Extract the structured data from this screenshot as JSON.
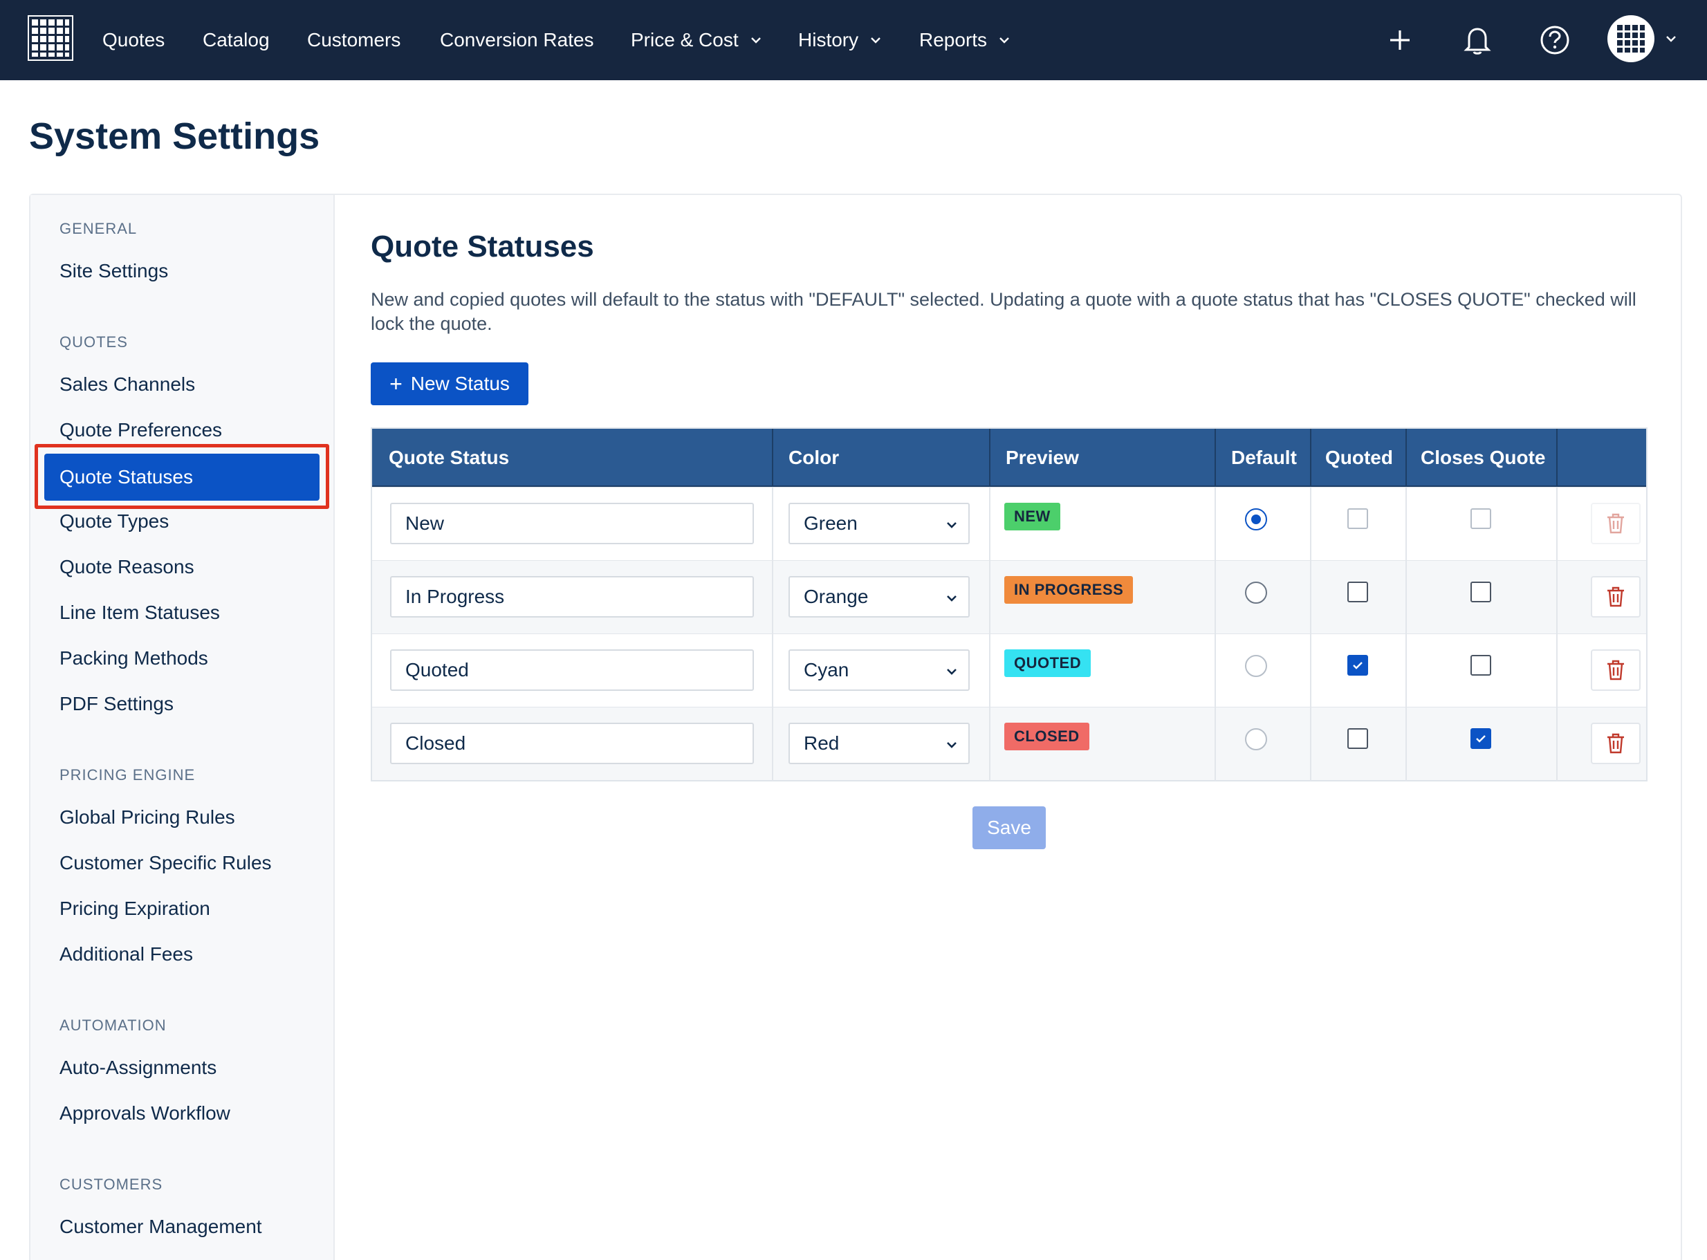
{
  "nav": {
    "logo_icon": "grid-logo-icon",
    "items": [
      {
        "label": "Quotes"
      },
      {
        "label": "Catalog"
      },
      {
        "label": "Customers"
      },
      {
        "label": "Conversion Rates"
      },
      {
        "label": "Price & Cost"
      },
      {
        "label": "History"
      },
      {
        "label": "Reports"
      }
    ],
    "icons": [
      "plus-icon",
      "bell-icon",
      "help-icon",
      "avatar-icon"
    ]
  },
  "page": {
    "title": "System Settings"
  },
  "sidebar": {
    "sections": [
      {
        "heading": "GENERAL",
        "items": [
          "Site Settings"
        ]
      },
      {
        "heading": "QUOTES",
        "items": [
          "Sales Channels",
          "Quote Preferences",
          "Quote Statuses",
          "Quote Types",
          "Quote Reasons",
          "Line Item Statuses",
          "Packing Methods",
          "PDF Settings"
        ]
      },
      {
        "heading": "PRICING ENGINE",
        "items": [
          "Global Pricing Rules",
          "Customer Specific Rules",
          "Pricing Expiration",
          "Additional Fees"
        ]
      },
      {
        "heading": "AUTOMATION",
        "items": [
          "Auto-Assignments",
          "Approvals Workflow"
        ]
      },
      {
        "heading": "CUSTOMERS",
        "items": [
          "Customer Management"
        ]
      }
    ],
    "active": "Quote Statuses"
  },
  "main": {
    "title": "Quote Statuses",
    "description": "New and copied quotes will default to the status with \"DEFAULT\" selected. Updating a quote with a quote status that has \"CLOSES QUOTE\" checked will lock the quote.",
    "new_button": "New Status",
    "save_button": "Save",
    "columns": [
      "Quote Status",
      "Color",
      "Preview",
      "Default",
      "Quoted",
      "Closes Quote"
    ],
    "rows": [
      {
        "name": "New",
        "color": "Green",
        "preview": "NEW",
        "preview_bg": "#4ccf6b",
        "default": true,
        "quoted": false,
        "closes": false
      },
      {
        "name": "In Progress",
        "color": "Orange",
        "preview": "IN PROGRESS",
        "preview_bg": "#f08a3c",
        "default": false,
        "quoted": false,
        "closes": false
      },
      {
        "name": "Quoted",
        "color": "Cyan",
        "preview": "QUOTED",
        "preview_bg": "#35e2f2",
        "default": false,
        "quoted": true,
        "closes": false
      },
      {
        "name": "Closed",
        "color": "Red",
        "preview": "CLOSED",
        "preview_bg": "#f06b66",
        "default": false,
        "quoted": false,
        "closes": true
      }
    ]
  },
  "colors": {
    "nav_bg": "#16263f",
    "accent": "#0b53c5",
    "table_header": "#2b5a92",
    "danger": "#c0392b"
  }
}
